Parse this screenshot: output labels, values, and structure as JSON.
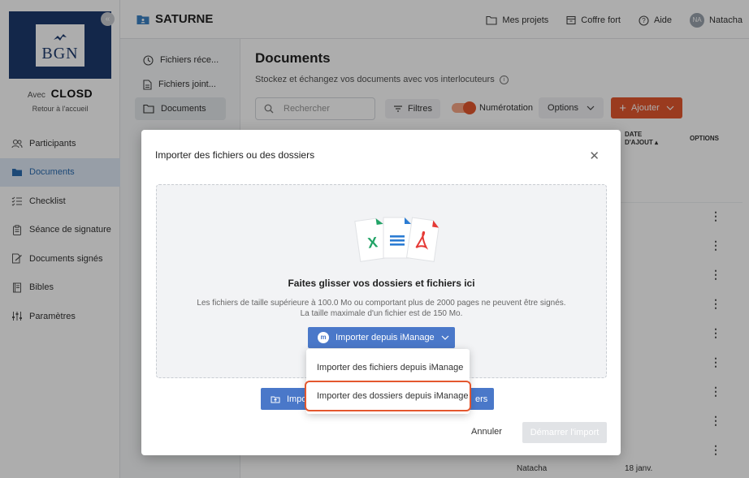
{
  "app": {
    "title": "SATURNE"
  },
  "brand": {
    "logo_text": "BGN",
    "with_label": "Avec",
    "partner": "CLOSD",
    "back_link": "Retour à l'accueil"
  },
  "sidebar": {
    "items": [
      {
        "label": "Participants",
        "icon": "users-icon"
      },
      {
        "label": "Documents",
        "icon": "folder-icon"
      },
      {
        "label": "Checklist",
        "icon": "checklist-icon"
      },
      {
        "label": "Séance de signature",
        "icon": "clipboard-icon"
      },
      {
        "label": "Documents signés",
        "icon": "signed-doc-icon"
      },
      {
        "label": "Bibles",
        "icon": "book-icon"
      },
      {
        "label": "Paramètres",
        "icon": "sliders-icon"
      }
    ]
  },
  "topbar": {
    "projects": "Mes projets",
    "vault": "Coffre fort",
    "help": "Aide",
    "user_initials": "NA",
    "user_name": "Natacha"
  },
  "subnav": {
    "recent": "Fichiers réce...",
    "attached": "Fichiers joint...",
    "documents": "Documents"
  },
  "main": {
    "title": "Documents",
    "subtitle": "Stockez et échangez vos documents avec vos interlocuteurs",
    "search_placeholder": "Rechercher",
    "filters": "Filtres",
    "numbering": "Numérotation",
    "options": "Options",
    "add": "Ajouter",
    "col_date_line1": "DATE",
    "col_date_line2": "D'AJOUT",
    "col_options": "OPTIONS",
    "last_row_user": "Natacha",
    "last_row_date": "18 janv."
  },
  "modal": {
    "title": "Importer des fichiers ou des dossiers",
    "drop_title": "Faites glisser vos dossiers et fichiers ici",
    "drop_desc_line1": "Les fichiers de taille supérieure à 100.0 Mo ou comportant plus de 2000 pages ne peuvent être signés.",
    "drop_desc_line2": "La taille maximale d'un fichier est de 150 Mo.",
    "imanage_button": "Importer depuis iManage",
    "import_left": "Impo",
    "import_right": "ers",
    "cancel": "Annuler",
    "start": "Démarrer l'import"
  },
  "dropdown": {
    "items": [
      "Importer des fichiers depuis iManage",
      "Importer des dossiers depuis iManage"
    ]
  },
  "colors": {
    "accent": "#e4572e",
    "primary": "#4a78c9",
    "navy": "#1d3a6e"
  }
}
